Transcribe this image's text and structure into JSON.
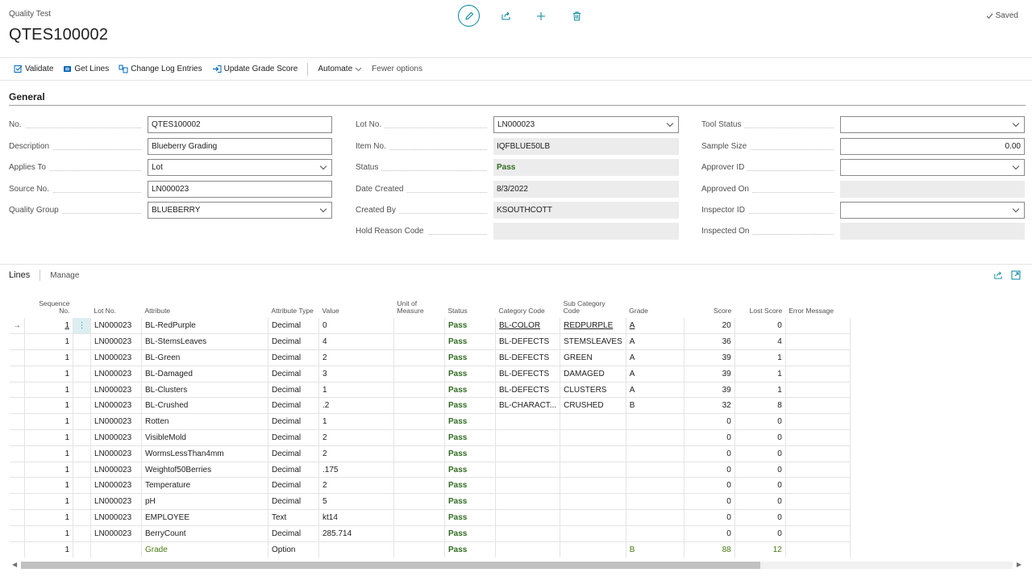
{
  "header": {
    "caption": "Quality Test",
    "title": "QTES100002",
    "saved_label": "Saved"
  },
  "actions": {
    "validate": "Validate",
    "get_lines": "Get Lines",
    "change_log": "Change Log Entries",
    "update_grade": "Update Grade Score",
    "automate": "Automate",
    "fewer": "Fewer options"
  },
  "general": {
    "title": "General",
    "no_label": "No.",
    "no_value": "QTES100002",
    "desc_label": "Description",
    "desc_value": "Blueberry Grading",
    "applies_label": "Applies To",
    "applies_value": "Lot",
    "source_label": "Source No.",
    "source_value": "LN000023",
    "group_label": "Quality Group",
    "group_value": "BLUEBERRY",
    "lot_label": "Lot No.",
    "lot_value": "LN000023",
    "item_label": "Item No.",
    "item_value": "IQFBLUE50LB",
    "status_label": "Status",
    "status_value": "Pass",
    "date_label": "Date Created",
    "date_value": "8/3/2022",
    "created_label": "Created By",
    "created_value": "KSOUTHCOTT",
    "hold_label": "Hold Reason Code",
    "hold_value": "",
    "tool_label": "Tool Status",
    "tool_value": "",
    "sample_label": "Sample Size",
    "sample_value": "0.00",
    "approver_label": "Approver ID",
    "approver_value": "",
    "approved_on_label": "Approved On",
    "approved_on_value": "",
    "inspector_label": "Inspector ID",
    "inspector_value": "",
    "inspected_on_label": "Inspected On",
    "inspected_on_value": ""
  },
  "lines": {
    "tab": "Lines",
    "manage": "Manage",
    "columns": {
      "seq": "Sequence No.",
      "lot": "Lot No.",
      "attribute": "Attribute",
      "type": "Attribute Type",
      "value": "Value",
      "uom": "Unit of Measure",
      "status": "Status",
      "cat": "Category Code",
      "subcat": "Sub Category Code",
      "grade": "Grade",
      "score": "Score",
      "lost": "Lost Score",
      "error": "Error Message"
    },
    "rows": [
      {
        "seq": "1",
        "lot": "LN000023",
        "attribute": "BL-RedPurple",
        "type": "Decimal",
        "value": "0",
        "uom": "",
        "status": "Pass",
        "cat": "BL-COLOR",
        "subcat": "REDPURPLE",
        "grade": "A",
        "score": "20",
        "lost": "0",
        "error": ""
      },
      {
        "seq": "1",
        "lot": "LN000023",
        "attribute": "BL-StemsLeaves",
        "type": "Decimal",
        "value": "4",
        "uom": "",
        "status": "Pass",
        "cat": "BL-DEFECTS",
        "subcat": "STEMSLEAVES",
        "grade": "A",
        "score": "36",
        "lost": "4",
        "error": ""
      },
      {
        "seq": "1",
        "lot": "LN000023",
        "attribute": "BL-Green",
        "type": "Decimal",
        "value": "2",
        "uom": "",
        "status": "Pass",
        "cat": "BL-DEFECTS",
        "subcat": "GREEN",
        "grade": "A",
        "score": "39",
        "lost": "1",
        "error": ""
      },
      {
        "seq": "1",
        "lot": "LN000023",
        "attribute": "BL-Damaged",
        "type": "Decimal",
        "value": "3",
        "uom": "",
        "status": "Pass",
        "cat": "BL-DEFECTS",
        "subcat": "DAMAGED",
        "grade": "A",
        "score": "39",
        "lost": "1",
        "error": ""
      },
      {
        "seq": "1",
        "lot": "LN000023",
        "attribute": "BL-Clusters",
        "type": "Decimal",
        "value": "1",
        "uom": "",
        "status": "Pass",
        "cat": "BL-DEFECTS",
        "subcat": "CLUSTERS",
        "grade": "A",
        "score": "39",
        "lost": "1",
        "error": ""
      },
      {
        "seq": "1",
        "lot": "LN000023",
        "attribute": "BL-Crushed",
        "type": "Decimal",
        "value": ".2",
        "uom": "",
        "status": "Pass",
        "cat": "BL-CHARACT...",
        "subcat": "CRUSHED",
        "grade": "B",
        "score": "32",
        "lost": "8",
        "error": ""
      },
      {
        "seq": "1",
        "lot": "LN000023",
        "attribute": "Rotten",
        "type": "Decimal",
        "value": "1",
        "uom": "",
        "status": "Pass",
        "cat": "",
        "subcat": "",
        "grade": "",
        "score": "0",
        "lost": "0",
        "error": ""
      },
      {
        "seq": "1",
        "lot": "LN000023",
        "attribute": "VisibleMold",
        "type": "Decimal",
        "value": "2",
        "uom": "",
        "status": "Pass",
        "cat": "",
        "subcat": "",
        "grade": "",
        "score": "0",
        "lost": "0",
        "error": ""
      },
      {
        "seq": "1",
        "lot": "LN000023",
        "attribute": "WormsLessThan4mm",
        "type": "Decimal",
        "value": "2",
        "uom": "",
        "status": "Pass",
        "cat": "",
        "subcat": "",
        "grade": "",
        "score": "0",
        "lost": "0",
        "error": ""
      },
      {
        "seq": "1",
        "lot": "LN000023",
        "attribute": "Weightof50Berries",
        "type": "Decimal",
        "value": ".175",
        "uom": "",
        "status": "Pass",
        "cat": "",
        "subcat": "",
        "grade": "",
        "score": "0",
        "lost": "0",
        "error": ""
      },
      {
        "seq": "1",
        "lot": "LN000023",
        "attribute": "Temperature",
        "type": "Decimal",
        "value": "2",
        "uom": "",
        "status": "Pass",
        "cat": "",
        "subcat": "",
        "grade": "",
        "score": "0",
        "lost": "0",
        "error": ""
      },
      {
        "seq": "1",
        "lot": "LN000023",
        "attribute": "pH",
        "type": "Decimal",
        "value": "5",
        "uom": "",
        "status": "Pass",
        "cat": "",
        "subcat": "",
        "grade": "",
        "score": "0",
        "lost": "0",
        "error": ""
      },
      {
        "seq": "1",
        "lot": "LN000023",
        "attribute": "EMPLOYEE",
        "type": "Text",
        "value": "kt14",
        "uom": "",
        "status": "Pass",
        "cat": "",
        "subcat": "",
        "grade": "",
        "score": "0",
        "lost": "0",
        "error": ""
      },
      {
        "seq": "1",
        "lot": "LN000023",
        "attribute": "BerryCount",
        "type": "Decimal",
        "value": "285.714",
        "uom": "",
        "status": "Pass",
        "cat": "",
        "subcat": "",
        "grade": "",
        "score": "0",
        "lost": "0",
        "error": ""
      },
      {
        "seq": "1",
        "lot": "",
        "attribute": "Grade",
        "type": "Option",
        "value": "",
        "uom": "",
        "status": "Pass",
        "cat": "",
        "subcat": "",
        "grade": "B",
        "score": "88",
        "lost": "12",
        "error": ""
      }
    ]
  }
}
